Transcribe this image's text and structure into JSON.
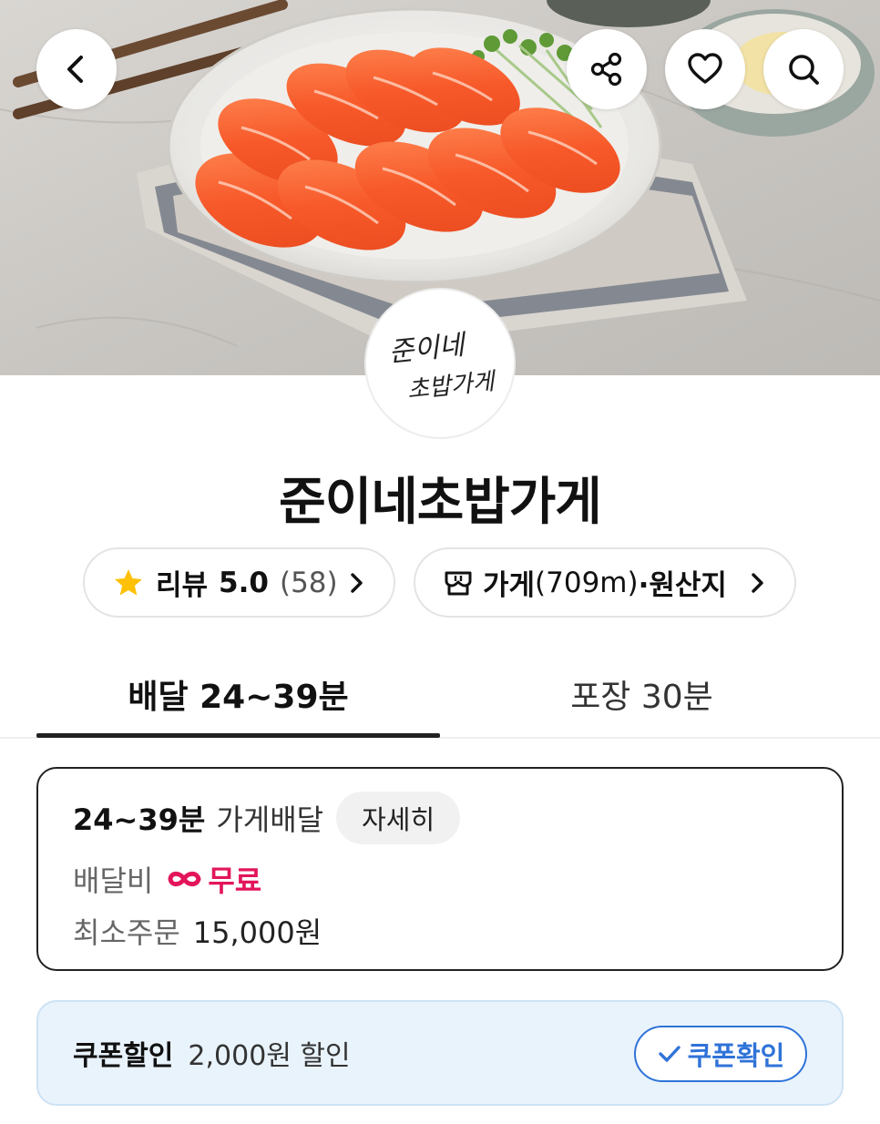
{
  "store": {
    "name": "준이네초밥가게",
    "logo_text_line1": "준이네",
    "logo_text_line2": "초밥가게"
  },
  "header": {
    "back_icon": "chevron-left-icon",
    "share_icon": "share-icon",
    "like_icon": "heart-icon",
    "search_icon": "search-icon"
  },
  "review_pill": {
    "label": "리뷰",
    "rating": "5.0",
    "count": "(58)"
  },
  "info_pill": {
    "label": "가게",
    "distance": "(709m)",
    "suffix": "·원산지"
  },
  "tabs": [
    {
      "label": "배달 24~39분",
      "active": true
    },
    {
      "label": "포장 30분",
      "active": false
    }
  ],
  "delivery": {
    "time": "24~39분",
    "type": "가게배달",
    "detail_label": "자세히",
    "fee_label": "배달비",
    "fee_value": "무료",
    "min_order_label": "최소주문",
    "min_order_value": "15,000원"
  },
  "coupon": {
    "label": "쿠폰할인",
    "discount": "2,000원 할인",
    "button_label": "쿠폰확인"
  },
  "colors": {
    "free_accent": "#e3155b",
    "coupon_blue": "#2f73d8",
    "coupon_bg": "#e9f3fc",
    "star": "#ffc107"
  }
}
